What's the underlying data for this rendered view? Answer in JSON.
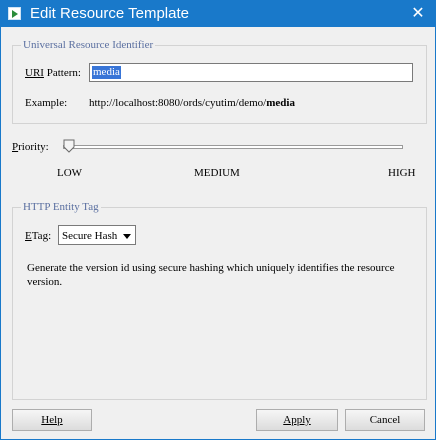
{
  "window": {
    "title": "Edit Resource Template",
    "close_glyph": "✕",
    "title_icon": "play-icon"
  },
  "uri_group": {
    "title": "Universal Resource Identifier",
    "uri_label_prefix": "URI",
    "uri_label_suffix": " Pattern:",
    "uri_value": "media",
    "example_label": "Example:",
    "example_prefix": "http://localhost:8080/ords/cyutim/demo/",
    "example_bold": "media"
  },
  "priority": {
    "label_first": "P",
    "label_rest": "riority:",
    "level": 0,
    "ticks": [
      "LOW",
      "MEDIUM",
      "HIGH"
    ]
  },
  "etag_group": {
    "title": "HTTP Entity Tag",
    "etag_label_first": "E",
    "etag_label_rest": "Tag:",
    "selected": "Secure Hash",
    "description": "Generate the version id using secure hashing which uniquely identifies the resource version."
  },
  "buttons": {
    "help": "Help",
    "apply": "Apply",
    "cancel": "Cancel"
  },
  "colors": {
    "titlebar": "#1979ca",
    "selection": "#3875d7"
  }
}
